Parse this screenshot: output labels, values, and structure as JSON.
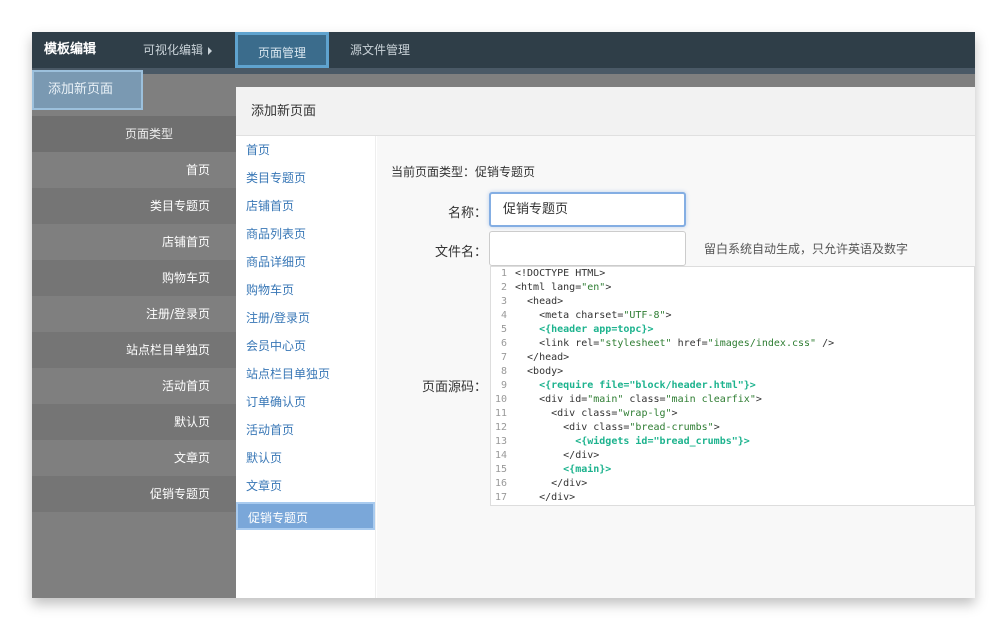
{
  "navbar": {
    "brand": "模板编辑",
    "visual_edit": "可视化编辑",
    "page_manage": "页面管理",
    "source_manage": "源文件管理"
  },
  "add_button": "添加新页面",
  "background_list": {
    "header": "页面类型",
    "items": [
      "首页",
      "类目专题页",
      "店铺首页",
      "购物车页",
      "注册/登录页",
      "站点栏目单独页",
      "活动首页",
      "默认页",
      "文章页",
      "促销专题页"
    ]
  },
  "modal": {
    "title": "添加新页面",
    "side_items": [
      "首页",
      "类目专题页",
      "店铺首页",
      "商品列表页",
      "商品详细页",
      "购物车页",
      "注册/登录页",
      "会员中心页",
      "站点栏目单独页",
      "订单确认页",
      "活动首页",
      "默认页",
      "文章页",
      "促销专题页"
    ],
    "active_item": "促销专题页",
    "current_type_label": "当前页面类型：促销专题页",
    "name_label": "名称：",
    "name_value": "促销专题页",
    "filename_label": "文件名：",
    "filename_value": "",
    "filename_hint": "留白系统自动生成，只允许英语及数字",
    "source_label": "页面源码：",
    "code_lines": [
      "<!DOCTYPE HTML>",
      "<html lang=\"en\">",
      "  <head>",
      "    <meta charset=\"UTF-8\">",
      "    <{header app=topc}>",
      "    <link rel=\"stylesheet\" href=\"images/index.css\" />",
      "  </head>",
      "  <body>",
      "    <{require file=\"block/header.html\"}>",
      "    <div id=\"main\" class=\"main clearfix\">",
      "      <div class=\"wrap-lg\">",
      "        <div class=\"bread-crumbs\">",
      "          <{widgets id=\"bread_crumbs\"}>",
      "        </div>",
      "        <{main}>",
      "      </div>",
      "    </div>"
    ]
  },
  "colors": {
    "navbar_bg": "#2f3e48",
    "active_tab": "#3b6c8c",
    "link": "#3877b6",
    "active_side": "#7aa7d9",
    "template_tag": "#1db38e"
  }
}
